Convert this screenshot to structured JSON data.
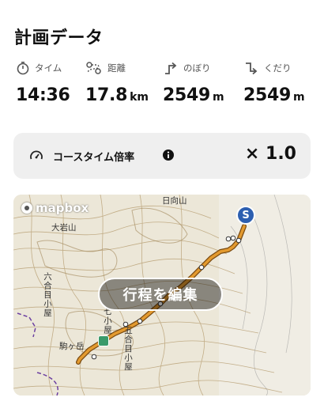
{
  "page": {
    "title": "計画データ"
  },
  "stats": [
    {
      "icon": "stopwatch-icon",
      "label": "タイム",
      "value": "14:36",
      "unit": ""
    },
    {
      "icon": "route-distance-icon",
      "label": "距離",
      "value": "17.8",
      "unit": "km"
    },
    {
      "icon": "ascent-arrow-icon",
      "label": "のぼり",
      "value": "2549",
      "unit": "m"
    },
    {
      "icon": "descent-arrow-icon",
      "label": "くだり",
      "value": "2549",
      "unit": "m"
    }
  ],
  "course_time": {
    "label": "コースタイム倍率",
    "multiplier": "× 1.0"
  },
  "map": {
    "attribution": "mapbox",
    "edit_button": "行程を編集",
    "start_marker": "S",
    "labels": {
      "hinata": "日向山",
      "oiwa": "大岩山",
      "rokugome": "六合目小屋",
      "gogome": "五合目小屋",
      "komagatake": "駒ヶ岳",
      "shichi": "七",
      "ko": "小屋"
    },
    "route_color": "#e39a2f",
    "water_color": "#6b3fa0"
  }
}
